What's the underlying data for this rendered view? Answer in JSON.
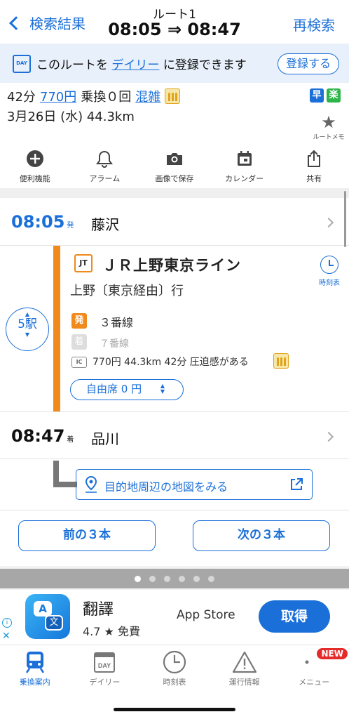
{
  "header": {
    "back_label": "検索結果",
    "route_label": "ルート1",
    "route_time": "08:05 ⇒ 08:47",
    "research_label": "再検索"
  },
  "daily_banner": {
    "icon_text": "DAY",
    "text_before": "このルートを",
    "link_text": "デイリー",
    "text_after": "に登録できます",
    "register_label": "登録する"
  },
  "summary": {
    "duration": "42分",
    "fare": "770円",
    "transfers": "乗換０回",
    "crowd_label": "混雑",
    "date_distance": "3月26日 (水) 44.3km",
    "badge_early": "早",
    "badge_easy": "楽",
    "route_memo_label": "ルートメモ"
  },
  "toolbar": {
    "items": [
      {
        "label": "便利機能",
        "icon": "plus-circle-icon"
      },
      {
        "label": "アラーム",
        "icon": "bell-icon"
      },
      {
        "label": "画像で保存",
        "icon": "camera-icon"
      },
      {
        "label": "カレンダー",
        "icon": "calendar-icon"
      },
      {
        "label": "共有",
        "icon": "share-icon"
      }
    ]
  },
  "route": {
    "departure": {
      "time": "08:05",
      "suffix": "発",
      "station": "藤沢"
    },
    "stations_count": "5駅",
    "line": {
      "badge": "JT",
      "name": "ＪＲ上野東京ライン",
      "destination": "上野〔東京経由〕行",
      "timetable_label": "時刻表",
      "dep_platform_badge": "発",
      "dep_platform": "３番線",
      "arr_platform_badge": "着",
      "arr_platform": "７番線",
      "ic_badge": "IC",
      "fare_info": "770円  44.3km  42分  圧迫感がある",
      "seat_select": "自由席 0 円"
    },
    "arrival": {
      "time": "08:47",
      "suffix": "着",
      "station": "品川"
    },
    "map_link": "目的地周辺の地図をみる",
    "prev_label": "前の３本",
    "next_label": "次の３本"
  },
  "pager": {
    "count": 6,
    "active": 0
  },
  "ad": {
    "title": "翻譯",
    "rating": "4.7 ★   免費",
    "store": "App Store",
    "get_label": "取得",
    "icon_a": "A",
    "icon_b": "文"
  },
  "tabbar": {
    "items": [
      {
        "label": "乗換案内",
        "icon": "train-icon",
        "active": true
      },
      {
        "label": "デイリー",
        "icon": "day-calendar-icon"
      },
      {
        "label": "時刻表",
        "icon": "clock-icon"
      },
      {
        "label": "運行情報",
        "icon": "warning-icon"
      },
      {
        "label": "メニュー",
        "icon": "menu-icon"
      }
    ],
    "new_badge": "NEW"
  },
  "colors": {
    "accent": "#1a6fd8",
    "line": "#f08a1c",
    "green": "#2db54a"
  }
}
